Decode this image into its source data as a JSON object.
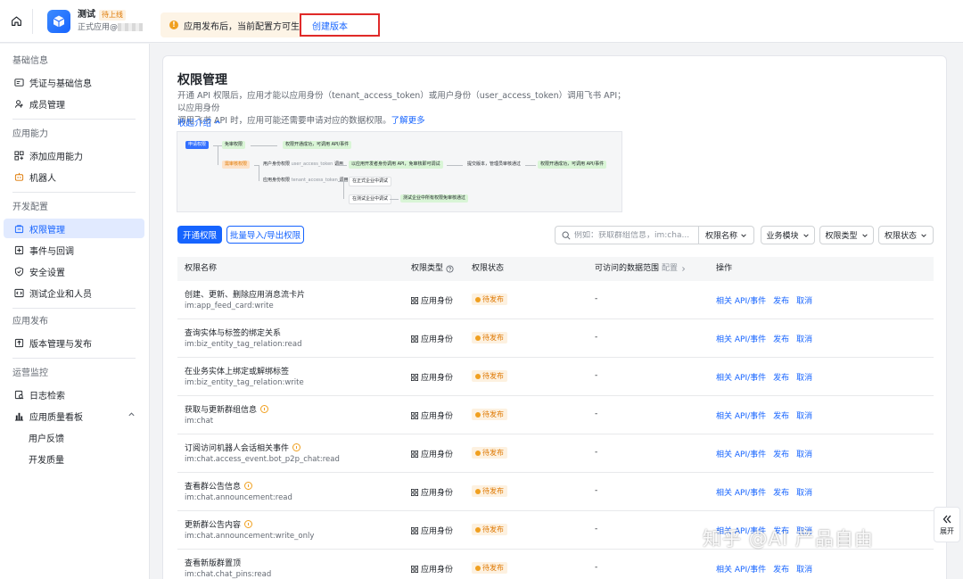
{
  "app": {
    "name": "测试",
    "status_badge": "待上线",
    "subtitle": "正式应用@",
    "notice": "应用发布后，当前配置方可生效",
    "create_version": "创建版本"
  },
  "sidebar": {
    "groups": [
      {
        "title": "基础信息",
        "items": [
          {
            "label": "凭证与基础信息",
            "icon": "credential-icon"
          },
          {
            "label": "成员管理",
            "icon": "member-icon"
          }
        ]
      },
      {
        "title": "应用能力",
        "items": [
          {
            "label": "添加应用能力",
            "icon": "capability-icon"
          },
          {
            "label": "机器人",
            "icon": "robot-icon"
          }
        ]
      },
      {
        "title": "开发配置",
        "items": [
          {
            "label": "权限管理",
            "icon": "permission-icon",
            "active": true
          },
          {
            "label": "事件与回调",
            "icon": "event-icon"
          },
          {
            "label": "安全设置",
            "icon": "security-icon"
          },
          {
            "label": "测试企业和人员",
            "icon": "test-icon"
          }
        ]
      },
      {
        "title": "应用发布",
        "items": [
          {
            "label": "版本管理与发布",
            "icon": "version-icon"
          }
        ]
      },
      {
        "title": "运营监控",
        "items": [
          {
            "label": "日志检索",
            "icon": "log-icon"
          },
          {
            "label": "应用质量看板",
            "icon": "quality-icon"
          },
          {
            "label": "用户反馈"
          },
          {
            "label": "开发质量"
          }
        ]
      }
    ]
  },
  "main": {
    "title": "权限管理",
    "desc_line1": "开通 API 权限后，应用才能以应用身份（tenant_access_token）或用户身份（user_access_token）调用飞书 API；以应用身份",
    "desc_line2": "调用飞书 API 时，应用可能还需要申请对应的数据权限。",
    "learn_more": "了解更多",
    "collapse": "收起介绍",
    "flow": {
      "apply": "申请权限",
      "free": "免审权限",
      "free_result": "权限开通成功，可调用 API/事件",
      "review": "需审核权限",
      "user_identity": "用户身份权限",
      "user_token": "user_access_token",
      "callable": "调用",
      "user_result": "以应用开发者身份调用 API，免审核即可调试",
      "submit": "提交版本，管理员审核通过",
      "final": "权限开通成功，可调用 API/事件",
      "app_identity": "应用身份权限",
      "tenant_token": "tenant_access_token",
      "prod_debug": "在正式企业中调试",
      "test_debug": "在测试企业中调试",
      "test_result": "测试企业中所有权限免审核通过"
    },
    "btn_open": "开通权限",
    "btn_batch": "批量导入/导出权限",
    "search_placeholder": "例如：获取群组信息，im:cha...",
    "search_select": "权限名称",
    "filters": [
      "业务模块",
      "权限类型",
      "权限状态"
    ],
    "columns": {
      "name": "权限名称",
      "type": "权限类型",
      "status": "权限状态",
      "scope": "可访问的数据范围",
      "scope_config": "配置",
      "ops": "操作"
    },
    "rows": [
      {
        "title": "创建、更新、删除应用消息流卡片",
        "code": "im:app_feed_card:write",
        "type": "应用身份",
        "status": "待发布",
        "scope": "-",
        "ops": [
          "相关 API/事件",
          "发布",
          "取消"
        ],
        "warn": false
      },
      {
        "title": "查询实体与标签的绑定关系",
        "code": "im:biz_entity_tag_relation:read",
        "type": "应用身份",
        "status": "待发布",
        "scope": "-",
        "ops": [
          "相关 API/事件",
          "发布",
          "取消"
        ],
        "warn": false
      },
      {
        "title": "在业务实体上绑定或解绑标签",
        "code": "im:biz_entity_tag_relation:write",
        "type": "应用身份",
        "status": "待发布",
        "scope": "-",
        "ops": [
          "相关 API/事件",
          "发布",
          "取消"
        ],
        "warn": false
      },
      {
        "title": "获取与更新群组信息",
        "code": "im:chat",
        "type": "应用身份",
        "status": "待发布",
        "scope": "-",
        "ops": [
          "相关 API/事件",
          "发布",
          "取消"
        ],
        "warn": true
      },
      {
        "title": "订阅访问机器人会话相关事件",
        "code": "im:chat.access_event.bot_p2p_chat:read",
        "type": "应用身份",
        "status": "待发布",
        "scope": "-",
        "ops": [
          "相关 API/事件",
          "发布",
          "取消"
        ],
        "warn": true
      },
      {
        "title": "查看群公告信息",
        "code": "im:chat.announcement:read",
        "type": "应用身份",
        "status": "待发布",
        "scope": "-",
        "ops": [
          "相关 API/事件",
          "发布",
          "取消"
        ],
        "warn": true
      },
      {
        "title": "更新群公告内容",
        "code": "im:chat.announcement:write_only",
        "type": "应用身份",
        "status": "待发布",
        "scope": "-",
        "ops": [
          "相关 API/事件",
          "发布",
          "取消"
        ],
        "warn": true
      },
      {
        "title": "查看新版群置顶",
        "code": "im:chat.chat_pins:read",
        "type": "应用身份",
        "status": "待发布",
        "scope": "-",
        "ops": [
          "相关 API/事件",
          "发布",
          "取消"
        ],
        "warn": false
      }
    ]
  },
  "expand_label": "展开",
  "watermark": "知乎 @AI 产品自由"
}
